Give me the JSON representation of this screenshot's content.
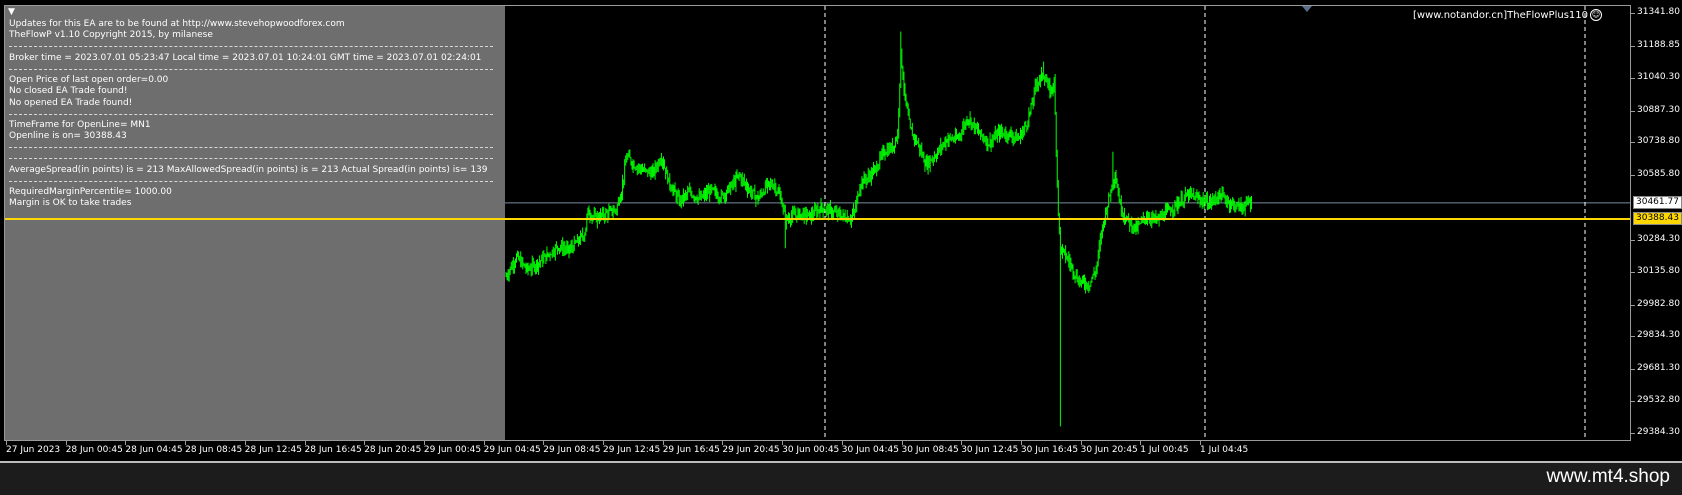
{
  "info_panel": {
    "lines": [
      {
        "text": "Updates for this EA are to be found at http://www.stevehopwoodforex.com"
      },
      {
        "text": "TheFlowP  v1.10 Copyright 2015, by milanese"
      },
      {
        "text": "Broker time = 2023.07.01 05:23:47 Local time = 2023.07.01 10:24:01 GMT time = 2023.07.01 02:24:01"
      },
      {
        "text": "Open Price of last open order=0.00"
      },
      {
        "text": "No closed EA Trade found!"
      },
      {
        "text": "No opened EA Trade found!"
      },
      {
        "text": "TimeFrame for OpenLine= MN1"
      },
      {
        "text": "Openline is on= 30388.43"
      },
      {
        "text": "AverageSpread(in points) is = 213 MaxAllowedSpread(in points) is = 213 Actual Spread(in points) is= 139"
      },
      {
        "text": "RequiredMarginPercentile= 1000.00"
      },
      {
        "text": "Margin is OK to take trades"
      }
    ]
  },
  "watermark": {
    "text": "[www.notandor.cn]TheFlowPlus110",
    "icon": "smiley-icon"
  },
  "price_axis": {
    "labels": [
      "31341.80",
      "31188.85",
      "31040.30",
      "30887.30",
      "30738.80",
      "30585.80",
      "30284.30",
      "30135.80",
      "29982.80",
      "29834.30",
      "29681.30",
      "29532.80",
      "29384.30"
    ],
    "current_price": "30461.77",
    "open_line_price": "30388.43"
  },
  "time_axis": {
    "labels": [
      "27 Jun 2023",
      "28 Jun 00:45",
      "28 Jun 04:45",
      "28 Jun 08:45",
      "28 Jun 12:45",
      "28 Jun 16:45",
      "28 Jun 20:45",
      "29 Jun 00:45",
      "29 Jun 04:45",
      "29 Jun 08:45",
      "29 Jun 12:45",
      "29 Jun 16:45",
      "29 Jun 20:45",
      "30 Jun 00:45",
      "30 Jun 04:45",
      "30 Jun 08:45",
      "30 Jun 12:45",
      "30 Jun 16:45",
      "30 Jun 20:45",
      "1 Jul 00:45",
      "1 Jul 04:45"
    ]
  },
  "chart_data": {
    "type": "candlestick",
    "price_range": [
      29384.3,
      31341.8
    ],
    "open_line": 30388.43,
    "current_price": 30461.77,
    "candle_color": "#00ff00",
    "open_line_color": "#ffd700",
    "bid_line_color": "#7a8ca0",
    "close_path": [
      [
        0,
        30120
      ],
      [
        10,
        30210
      ],
      [
        20,
        30150
      ],
      [
        30,
        30180
      ],
      [
        40,
        30220
      ],
      [
        50,
        30260
      ],
      [
        60,
        30240
      ],
      [
        70,
        30290
      ],
      [
        75,
        30320
      ],
      [
        78,
        30420
      ],
      [
        85,
        30390
      ],
      [
        95,
        30410
      ],
      [
        105,
        30430
      ],
      [
        110,
        30520
      ],
      [
        115,
        30680
      ],
      [
        122,
        30640
      ],
      [
        132,
        30610
      ],
      [
        140,
        30600
      ],
      [
        148,
        30680
      ],
      [
        155,
        30560
      ],
      [
        165,
        30470
      ],
      [
        175,
        30510
      ],
      [
        185,
        30480
      ],
      [
        195,
        30520
      ],
      [
        205,
        30490
      ],
      [
        215,
        30540
      ],
      [
        222,
        30590
      ],
      [
        232,
        30520
      ],
      [
        240,
        30480
      ],
      [
        248,
        30540
      ],
      [
        255,
        30550
      ],
      [
        262,
        30480
      ],
      [
        266,
        30380
      ],
      [
        272,
        30400
      ],
      [
        280,
        30410
      ],
      [
        290,
        30400
      ],
      [
        300,
        30440
      ],
      [
        310,
        30420
      ],
      [
        320,
        30400
      ],
      [
        328,
        30390
      ],
      [
        332,
        30420
      ],
      [
        338,
        30560
      ],
      [
        345,
        30580
      ],
      [
        352,
        30620
      ],
      [
        360,
        30700
      ],
      [
        368,
        30720
      ],
      [
        373,
        30780
      ],
      [
        376,
        31160
      ],
      [
        380,
        30950
      ],
      [
        385,
        30800
      ],
      [
        392,
        30740
      ],
      [
        400,
        30640
      ],
      [
        410,
        30690
      ],
      [
        420,
        30760
      ],
      [
        430,
        30760
      ],
      [
        440,
        30860
      ],
      [
        450,
        30790
      ],
      [
        460,
        30740
      ],
      [
        470,
        30790
      ],
      [
        480,
        30780
      ],
      [
        488,
        30760
      ],
      [
        495,
        30820
      ],
      [
        500,
        30900
      ],
      [
        505,
        31020
      ],
      [
        512,
        31060
      ],
      [
        518,
        30980
      ],
      [
        522,
        31020
      ],
      [
        526,
        30420
      ],
      [
        528,
        30250
      ],
      [
        535,
        30200
      ],
      [
        545,
        30100
      ],
      [
        555,
        30080
      ],
      [
        562,
        30150
      ],
      [
        568,
        30350
      ],
      [
        575,
        30500
      ],
      [
        580,
        30600
      ],
      [
        585,
        30450
      ],
      [
        590,
        30390
      ],
      [
        600,
        30340
      ],
      [
        610,
        30400
      ],
      [
        620,
        30380
      ],
      [
        630,
        30420
      ],
      [
        640,
        30460
      ],
      [
        650,
        30500
      ],
      [
        660,
        30480
      ],
      [
        670,
        30460
      ],
      [
        680,
        30500
      ],
      [
        690,
        30460
      ],
      [
        700,
        30440
      ],
      [
        710,
        30470
      ]
    ],
    "spikes": [
      {
        "at": 376,
        "high": 31260
      },
      {
        "at": 512,
        "high": 31120
      },
      {
        "at": 528,
        "low": 29420
      },
      {
        "at": 578,
        "high": 30700
      },
      {
        "at": 266,
        "low": 30250
      }
    ]
  },
  "colors": {
    "background": "#000000",
    "panel": "#6e6e6e",
    "candles": "#00ff00",
    "open_line": "#ffd700",
    "current_line": "#7a8ca0",
    "period_sep": "#ffffff"
  },
  "footer": {
    "site": "www.mt4.shop"
  }
}
